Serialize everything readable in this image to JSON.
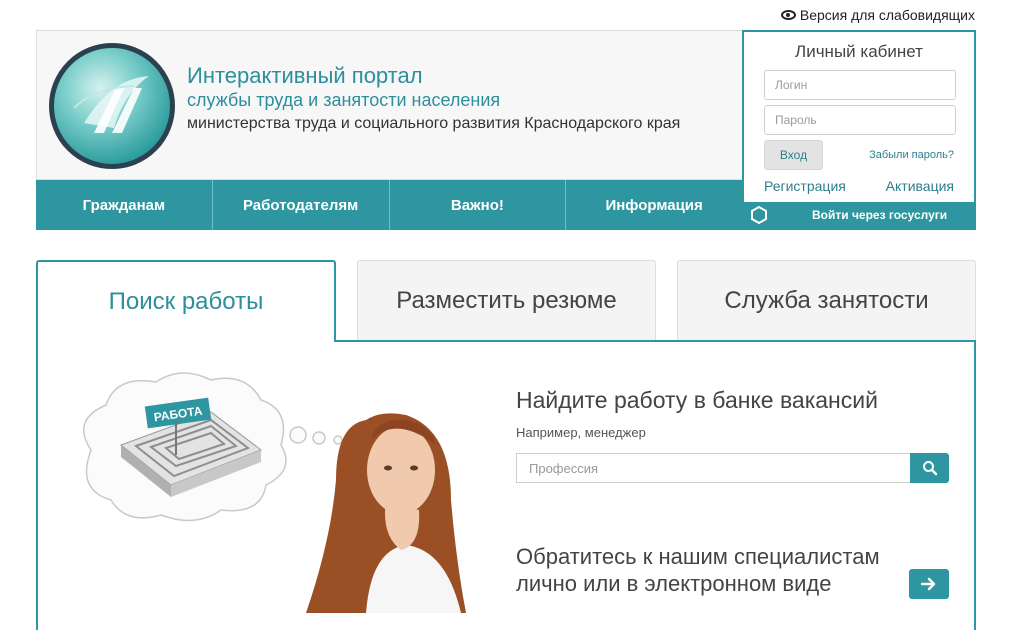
{
  "top": {
    "low_vision_label": "Версия для слабовидящих"
  },
  "header": {
    "title_line1": "Интерактивный портал",
    "title_line2": "службы труда и занятости населения",
    "title_line3": "министерства труда и социального развития Краснодарского края"
  },
  "nav": {
    "items": [
      {
        "label": "Гражданам"
      },
      {
        "label": "Работодателям"
      },
      {
        "label": "Важно!"
      },
      {
        "label": "Информация"
      }
    ]
  },
  "cabinet": {
    "title": "Личный кабинет",
    "login_placeholder": "Логин",
    "password_placeholder": "Пароль",
    "enter_label": "Вход",
    "forgot_label": "Забыли пароль?",
    "register_label": "Регистрация",
    "activate_label": "Активация",
    "gosuslugi_label": "Войти через госуслуги"
  },
  "tabs": [
    {
      "label": "Поиск работы",
      "active": true
    },
    {
      "label": "Разместить резюме",
      "active": false
    },
    {
      "label": "Служба занятости",
      "active": false
    }
  ],
  "illustration": {
    "sign_text": "РАБОТА"
  },
  "search": {
    "title": "Найдите работу в банке вакансий",
    "example": "Например, менеджер",
    "placeholder": "Профессия"
  },
  "contact": {
    "title": "Обратитесь к нашим специалистам лично или в электронном виде"
  },
  "colors": {
    "accent": "#2d96a0",
    "title_teal": "#2c8f9c",
    "logo_ring": "#2b4150"
  }
}
